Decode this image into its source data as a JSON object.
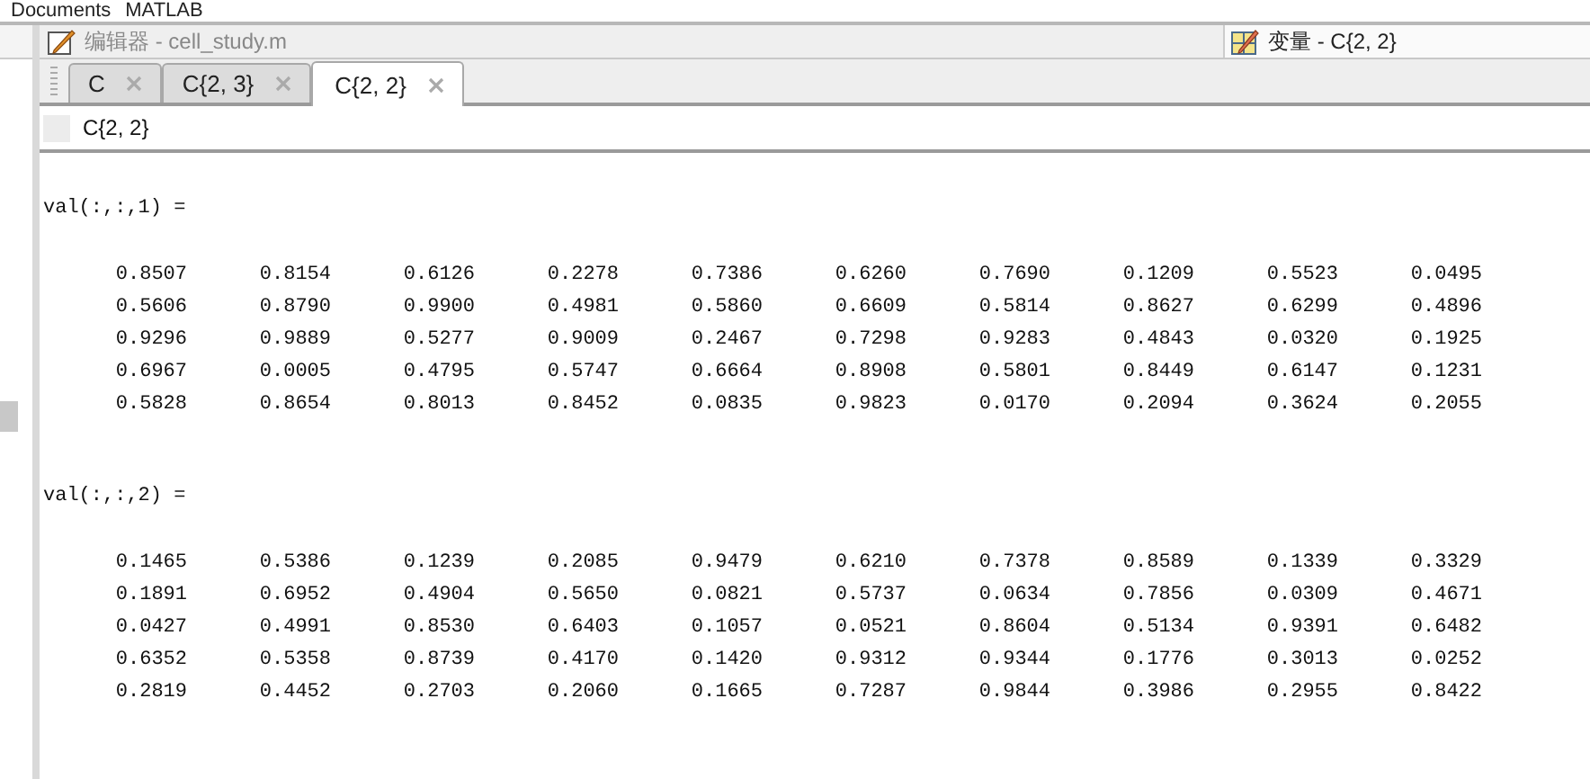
{
  "breadcrumb": [
    "Documents",
    "MATLAB"
  ],
  "editor_title": "编辑器 - cell_study.m",
  "variables_title": "变量 - C{2, 2}",
  "tabs": [
    {
      "label": "C",
      "selected": false
    },
    {
      "label": "C{2, 3}",
      "selected": false
    },
    {
      "label": "C{2, 2}",
      "selected": true
    }
  ],
  "variable_label": "C{2, 2}",
  "pages": [
    {
      "header": "val(:,:,1) =",
      "rows": [
        [
          "0.8507",
          "0.8154",
          "0.6126",
          "0.2278",
          "0.7386",
          "0.6260",
          "0.7690",
          "0.1209",
          "0.5523",
          "0.0495"
        ],
        [
          "0.5606",
          "0.8790",
          "0.9900",
          "0.4981",
          "0.5860",
          "0.6609",
          "0.5814",
          "0.8627",
          "0.6299",
          "0.4896"
        ],
        [
          "0.9296",
          "0.9889",
          "0.5277",
          "0.9009",
          "0.2467",
          "0.7298",
          "0.9283",
          "0.4843",
          "0.0320",
          "0.1925"
        ],
        [
          "0.6967",
          "0.0005",
          "0.4795",
          "0.5747",
          "0.6664",
          "0.8908",
          "0.5801",
          "0.8449",
          "0.6147",
          "0.1231"
        ],
        [
          "0.5828",
          "0.8654",
          "0.8013",
          "0.8452",
          "0.0835",
          "0.9823",
          "0.0170",
          "0.2094",
          "0.3624",
          "0.2055"
        ]
      ]
    },
    {
      "header": "val(:,:,2) =",
      "rows": [
        [
          "0.1465",
          "0.5386",
          "0.1239",
          "0.2085",
          "0.9479",
          "0.6210",
          "0.7378",
          "0.8589",
          "0.1339",
          "0.3329"
        ],
        [
          "0.1891",
          "0.6952",
          "0.4904",
          "0.5650",
          "0.0821",
          "0.5737",
          "0.0634",
          "0.7856",
          "0.0309",
          "0.4671"
        ],
        [
          "0.0427",
          "0.4991",
          "0.8530",
          "0.6403",
          "0.1057",
          "0.0521",
          "0.8604",
          "0.5134",
          "0.9391",
          "0.6482"
        ],
        [
          "0.6352",
          "0.5358",
          "0.8739",
          "0.4170",
          "0.1420",
          "0.9312",
          "0.9344",
          "0.1776",
          "0.3013",
          "0.0252"
        ],
        [
          "0.2819",
          "0.4452",
          "0.2703",
          "0.2060",
          "0.1665",
          "0.7287",
          "0.9844",
          "0.3986",
          "0.2955",
          "0.8422"
        ]
      ]
    }
  ]
}
